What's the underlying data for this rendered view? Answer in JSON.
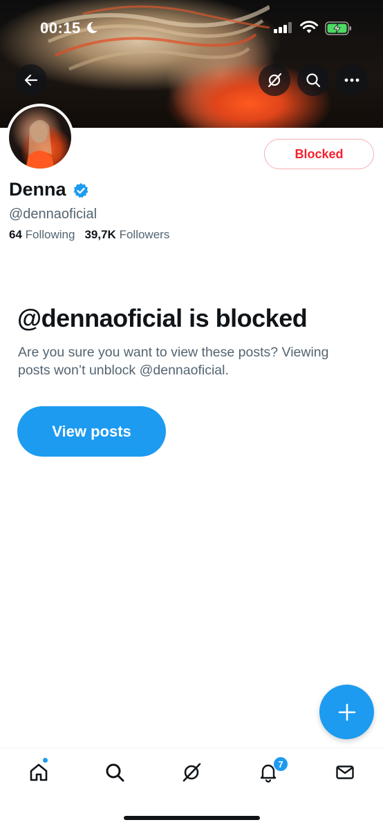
{
  "status_bar": {
    "time": "00:15",
    "icons": [
      "moon-icon",
      "signal-icon",
      "wifi-icon",
      "battery-charging-icon"
    ]
  },
  "header": {
    "buttons": [
      "back-arrow-icon",
      "grok-icon",
      "search-icon",
      "more-icon"
    ]
  },
  "profile": {
    "display_name": "Denna",
    "verified": true,
    "handle": "@dennaoficial",
    "following_count": "64",
    "following_label": "Following",
    "followers_count": "39,7K",
    "followers_label": "Followers",
    "block_button_label": "Blocked"
  },
  "blocked_notice": {
    "title": "@dennaoficial is blocked",
    "description": "Are you sure you want to view these posts? Viewing posts won’t unblock @dennaoficial.",
    "button_label": "View posts"
  },
  "fab": {
    "icon": "plus-icon"
  },
  "tab_bar": {
    "items": [
      {
        "name": "home",
        "icon": "home-icon",
        "has_dot": true
      },
      {
        "name": "search",
        "icon": "search-icon"
      },
      {
        "name": "grok",
        "icon": "grok-icon"
      },
      {
        "name": "notifications",
        "icon": "bell-icon",
        "badge": "7"
      },
      {
        "name": "messages",
        "icon": "mail-icon"
      }
    ]
  },
  "colors": {
    "accent": "#1d9bf0",
    "blocked_red": "#f4212e",
    "text_primary": "#0f1419",
    "text_secondary": "#536471"
  }
}
